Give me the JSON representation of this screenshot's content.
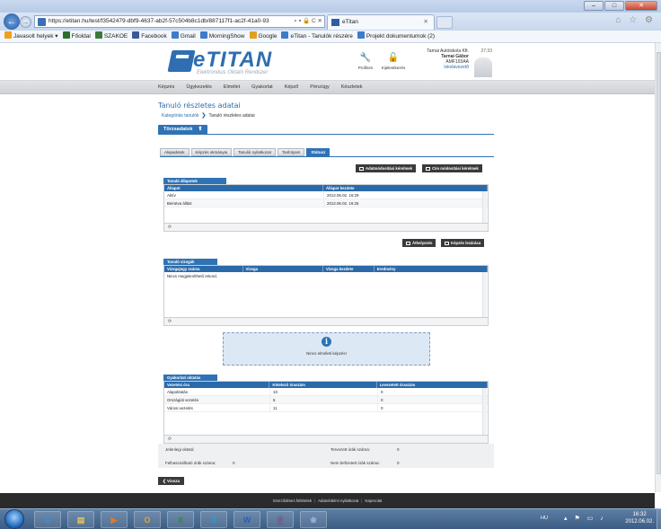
{
  "browser": {
    "url": "https://etitan.hu/test/f3542479-dbf9-4637-ab2f-57c504b8c1db/887117f1-ac2f-41a0-93",
    "address_tools": "⌕ ▾ 🔒 C ✕",
    "tab_title": "eTitan",
    "tab_close": "✕",
    "favorites": [
      {
        "label": "Javasolt helyek ▾",
        "color": "#f0a020"
      },
      {
        "label": "Főoldal",
        "color": "#2d6e2d"
      },
      {
        "label": "SZAKOE",
        "color": "#3b7a3b"
      },
      {
        "label": "Facebook",
        "color": "#3b5998"
      },
      {
        "label": "Gmail",
        "color": "#3d7cc9"
      },
      {
        "label": "MorningShow",
        "color": "#3d7cc9"
      },
      {
        "label": "Google",
        "color": "#e0a020"
      },
      {
        "label": "eTitan - Tanulók részére",
        "color": "#3d7cc9"
      },
      {
        "label": "Projekt dokumentumok (2)",
        "color": "#3d7cc9"
      }
    ],
    "window_buttons": [
      "–",
      "□",
      "✕"
    ],
    "toolbar_icons": "⌂ ☆ ⚙"
  },
  "header": {
    "logo_name": "eTITAN",
    "logo_sub": "Elektronikus Oktató Rendszer",
    "profile_label": "Profilom",
    "logout_label": "Kijelentkezés",
    "user": {
      "school": "Tarnai Autóiskola Kft.",
      "name": "Tarnai Gábor",
      "code": "AMF193AA",
      "role": "Iskolavezető",
      "time": "27:33"
    }
  },
  "menu": [
    "Képzés",
    "Ügykezelés",
    "Elmélet",
    "Gyakorlat",
    "Képző",
    "Pénzügy",
    "Készletek"
  ],
  "page": {
    "title": "Tanuló részletes adatai",
    "breadcrumb": {
      "link": "Kategóriás tanulók",
      "sep": "❯",
      "current": "Tanuló részletes adatai"
    },
    "main_tab": "Törzsadatok",
    "main_tab_arrow": "⬆",
    "subtabs": [
      {
        "label": "Alapadatok",
        "active": false
      },
      {
        "label": "Képzés okmányai",
        "active": false
      },
      {
        "label": "Tanulói nyilatkozat",
        "active": false
      },
      {
        "label": "Tanfolyam",
        "active": false
      },
      {
        "label": "Státusz",
        "active": true
      }
    ],
    "btn_data_change": "Adatmódosítási kérelmek",
    "btn_addr_change": "Cím módosítási kérelmek",
    "btn_move": "Áthelyezés",
    "btn_close_training": "Képzés lezárása",
    "back_label": "❮ Vissza"
  },
  "status_grid": {
    "title": "Tanuló állapotok",
    "headers": [
      "Állapot",
      "Állapot kezdete"
    ],
    "rows": [
      [
        "Aktív",
        "2012.06.02. 16:29"
      ],
      [
        "Beiratva állást",
        "2012.06.02. 16:25"
      ]
    ],
    "refresh": "⟳"
  },
  "exam_grid": {
    "title": "Tanuló vizsgák",
    "headers": [
      "Vizsgajegy száma",
      "Vizsga",
      "Vizsga kezdete",
      "Eredmény"
    ],
    "empty": "Nincs megjeleníthető rekord.",
    "refresh": "⟳"
  },
  "theory_info": {
    "icon": "i",
    "text": "Nincs elméleti képzés!"
  },
  "practice_grid": {
    "title": "Gyakorlati oktatás",
    "headers": [
      "Vezetési óra",
      "Kötelező óraszám",
      "Levezetett óraszám"
    ],
    "rows": [
      [
        "Alapoktatás",
        "10",
        "0"
      ],
      [
        "Országúti vezetés",
        "5",
        "0"
      ],
      [
        "Városi vezetés",
        "11",
        "0"
      ]
    ],
    "refresh": "⟳"
  },
  "summary": {
    "jelenlegi_label": "Jelenlegi oktató:",
    "jelenlegi_value": "",
    "tervezett_label": "Tervezett órák száma:",
    "tervezett_value": "0",
    "felhasznalhato_label": "Felhasználható órák száma:",
    "felhasznalhato_value": "0",
    "nem_befizetett_label": "Nem befizetett órák száma:",
    "nem_befizetett_value": "0"
  },
  "footer": [
    "Szerződéses feltételek",
    "Adatvédelmi nyilatkozat",
    "Kapcsolat"
  ],
  "taskbar": {
    "apps": [
      {
        "glyph": "e",
        "name": "ie-icon",
        "color": "#3a8fe0"
      },
      {
        "glyph": "▤",
        "name": "explorer-icon",
        "color": "#e7c55b"
      },
      {
        "glyph": "▶",
        "name": "media-icon",
        "color": "#e07a2a"
      },
      {
        "glyph": "O",
        "name": "outlook-icon",
        "color": "#f0a020"
      },
      {
        "glyph": "X",
        "name": "excel-icon",
        "color": "#2e8b3e"
      },
      {
        "glyph": "S",
        "name": "skype-icon",
        "color": "#1e9fe0"
      },
      {
        "glyph": "W",
        "name": "word-icon",
        "color": "#2a5fb5"
      },
      {
        "glyph": "▒",
        "name": "winrar-icon",
        "color": "#8a2a6a"
      },
      {
        "glyph": "❀",
        "name": "paint-icon",
        "color": "#9ab4d8"
      }
    ],
    "lang": "HU",
    "tray_icons": "▴ ⚑ ▭ ♪",
    "time": "16:32",
    "date": "2012.06.02."
  }
}
